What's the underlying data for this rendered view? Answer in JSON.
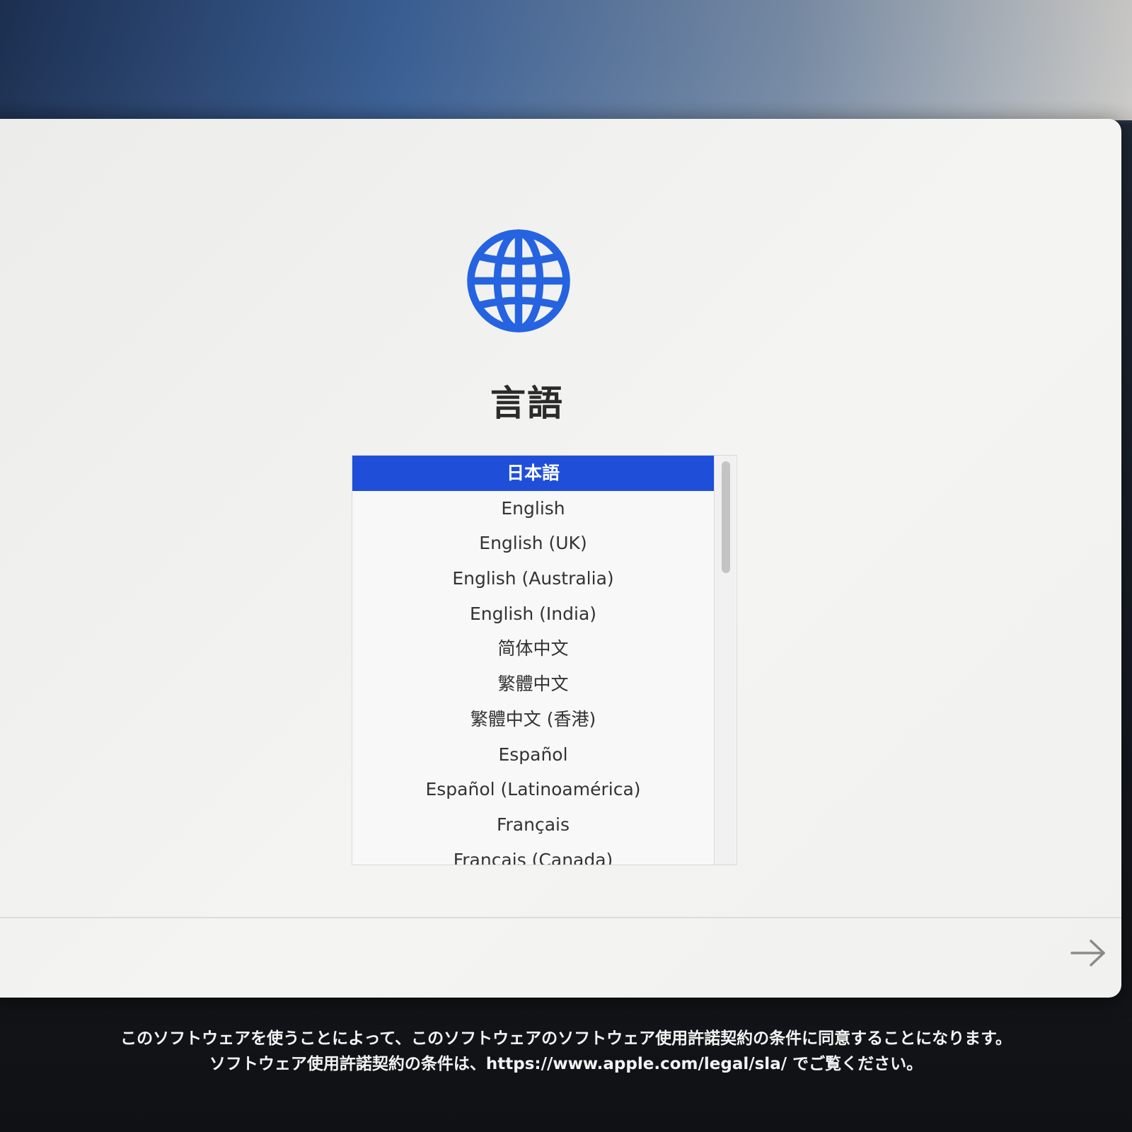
{
  "colors": {
    "accent": "#1f4fd9",
    "globe": "#2563e0",
    "window_bg": "#f2f2f0",
    "text": "#333333"
  },
  "header": {
    "icon": "globe-icon",
    "title": "言語"
  },
  "language_list": {
    "selected_index": 0,
    "items": [
      {
        "label": "日本語"
      },
      {
        "label": "English"
      },
      {
        "label": "English (UK)"
      },
      {
        "label": "English (Australia)"
      },
      {
        "label": "English (India)"
      },
      {
        "label": "简体中文"
      },
      {
        "label": "繁體中文"
      },
      {
        "label": "繁體中文 (香港)"
      },
      {
        "label": "Español"
      },
      {
        "label": "Español (Latinoamérica)"
      },
      {
        "label": "Français"
      },
      {
        "label": "Français (Canada)"
      }
    ]
  },
  "footer": {
    "next_icon": "arrow-right-icon"
  },
  "legal": {
    "line1": "このソフトウェアを使うことによって、このソフトウェアのソフトウェア使用許諾契約の条件に同意することになります。",
    "line2": "ソフトウェア使用許諾契約の条件は、https://www.apple.com/legal/sla/ でご覧ください。"
  }
}
